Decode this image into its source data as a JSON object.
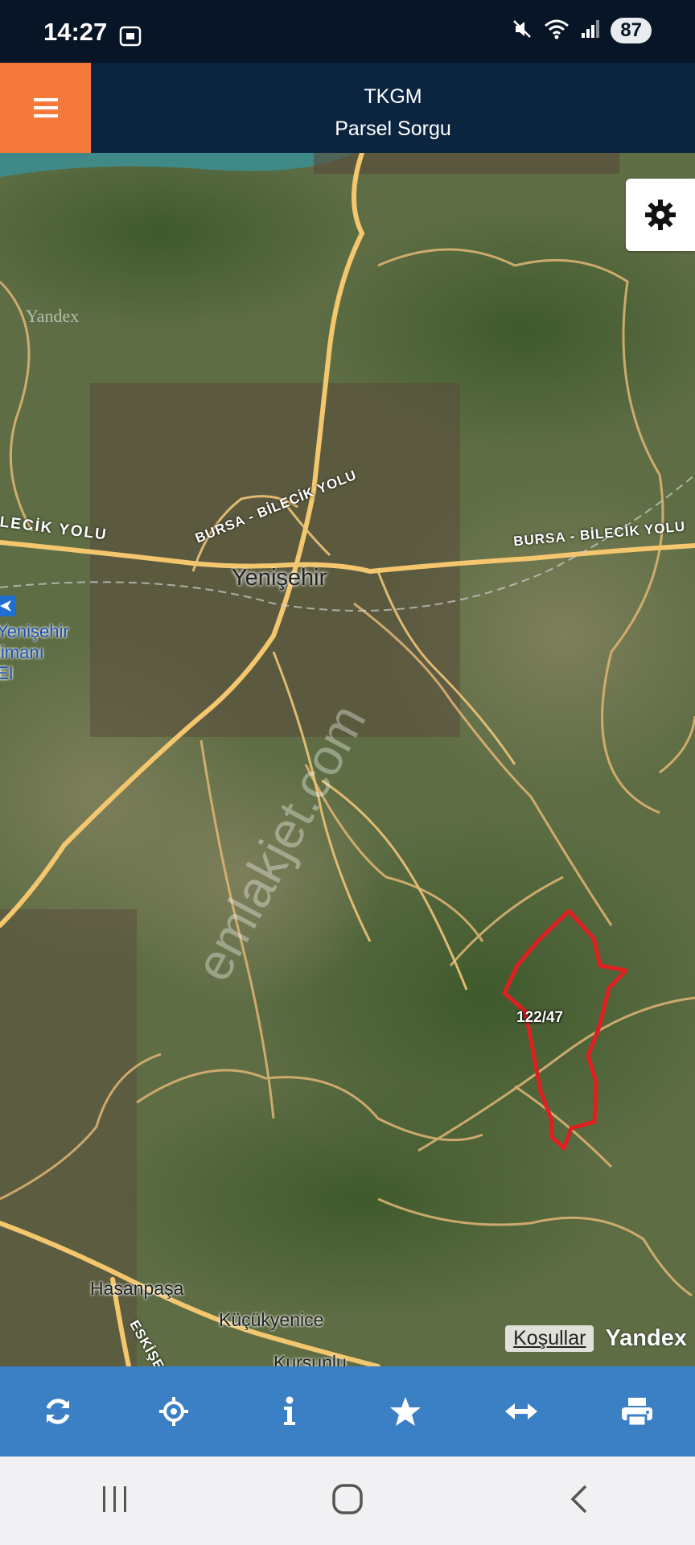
{
  "status": {
    "time": "14:27",
    "battery": "87"
  },
  "header": {
    "title": "TKGM",
    "subtitle": "Parsel Sorgu"
  },
  "map": {
    "road_labels": [
      "İLECİK YOLU",
      "BURSA - BİLECİK YOLU",
      "BURSA - BİLECİK YOLU",
      "ESKİŞE"
    ],
    "places": {
      "main": "Yenişehir",
      "airport_line1": "Yenişehir",
      "airport_line2": "limanı",
      "airport_line3": "EI",
      "hasanpasa": "Hasanpaşa",
      "kucukyenice": "Küçükyenice",
      "kursunlu": "Kurşunlu"
    },
    "provider_watermark": "Yandex",
    "watermark": "emlakjet.com",
    "parcel_label": "122/47",
    "attribution": {
      "terms": "Koşullar",
      "provider": "Yandex"
    }
  },
  "toolbar": [
    "refresh-icon",
    "locate-icon",
    "info-icon",
    "star-icon",
    "measure-icon",
    "print-icon"
  ],
  "colors": {
    "accent": "#f5793a",
    "header": "#0b2540",
    "toolbar": "#3b7fc4",
    "parcel": "#e02020"
  }
}
